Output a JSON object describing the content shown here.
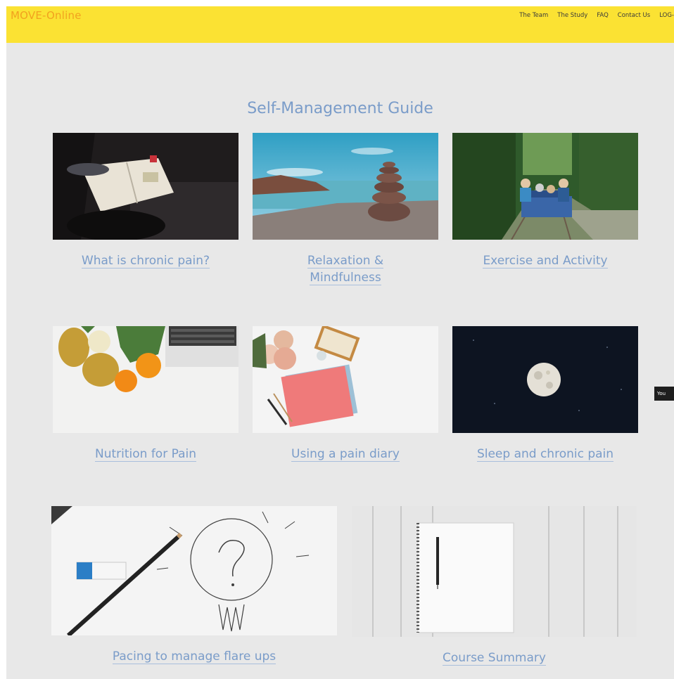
{
  "header": {
    "brand": "MOVE-Online",
    "nav": [
      "The Team",
      "The Study",
      "FAQ",
      "Contact Us",
      "LOG-"
    ]
  },
  "page": {
    "title": "Self-Management Guide"
  },
  "cards": [
    {
      "label": "What is chronic pain?"
    },
    {
      "label": "Relaxation & Mindfulness"
    },
    {
      "label": "Exercise and Activity"
    },
    {
      "label": "Nutrition for Pain"
    },
    {
      "label": "Using a pain diary"
    },
    {
      "label": "Sleep and chronic pain"
    },
    {
      "label": "Pacing to manage flare ups"
    },
    {
      "label": "Course Summary"
    }
  ],
  "tooltip": {
    "text": "You"
  }
}
